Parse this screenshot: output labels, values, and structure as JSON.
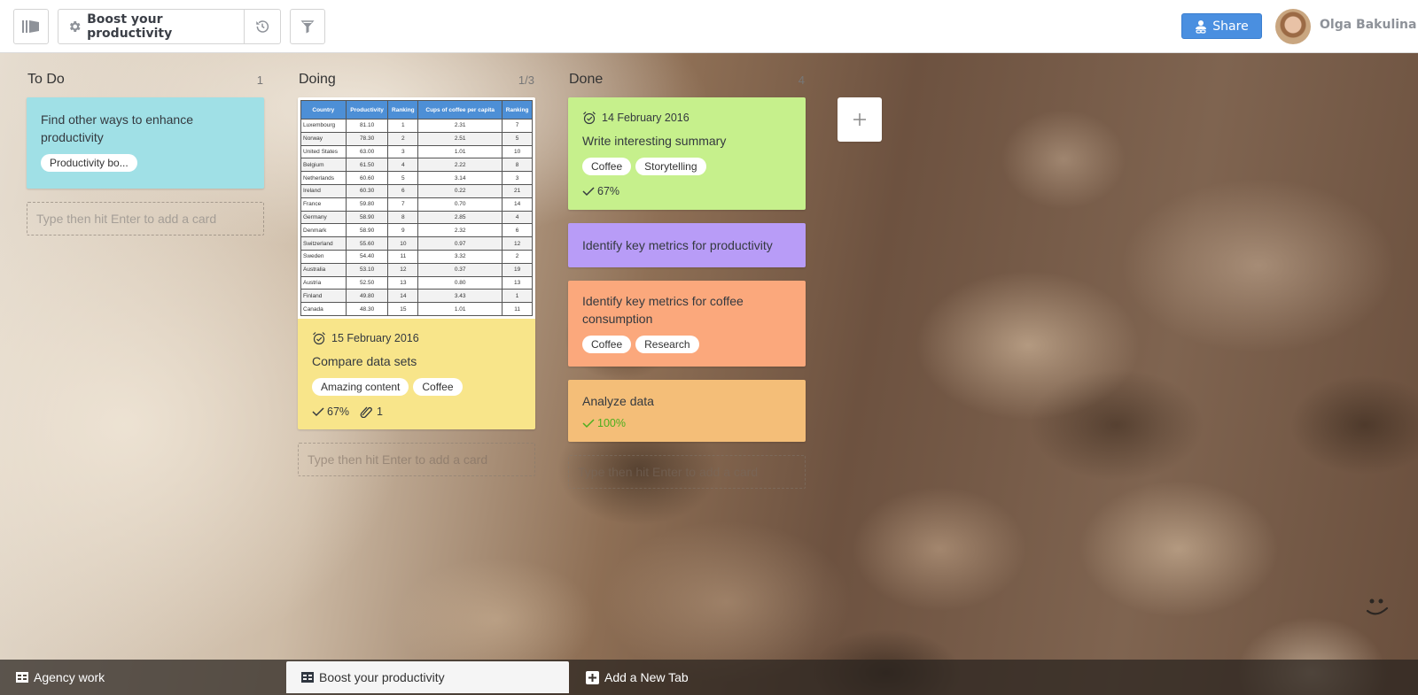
{
  "header": {
    "board_title": "Boost your productivity",
    "share_label": "Share",
    "user_name": "Olga Bakulina",
    "icons": {
      "sidebar_toggle": "sidebar-toggle-icon",
      "settings": "gear-icon",
      "history": "history-icon",
      "filter": "filter-icon",
      "share": "share-user-link-icon"
    },
    "accent_color": "#4a8fe0"
  },
  "lists": [
    {
      "title": "To Do",
      "count": "1",
      "cards": [
        {
          "title": "Find other ways to enhance productivity",
          "color": "#a0e0e6",
          "tags": [
            "Productivity bo..."
          ]
        }
      ],
      "add_placeholder": "Type then hit Enter to add a card"
    },
    {
      "title": "Doing",
      "count": "1/3",
      "cards": [
        {
          "color": "#f8e58a",
          "cover_table": {
            "headers": [
              "Country",
              "Productivity",
              "Ranking",
              "Cups of coffee per capita",
              "Ranking"
            ],
            "rows": [
              [
                "Luxembourg",
                "81.10",
                "1",
                "2.31",
                "7"
              ],
              [
                "Norway",
                "78.30",
                "2",
                "2.51",
                "5"
              ],
              [
                "United States",
                "63.00",
                "3",
                "1.01",
                "10"
              ],
              [
                "Belgium",
                "61.50",
                "4",
                "2.22",
                "8"
              ],
              [
                "Netherlands",
                "60.60",
                "5",
                "3.14",
                "3"
              ],
              [
                "Ireland",
                "60.30",
                "6",
                "0.22",
                "21"
              ],
              [
                "France",
                "59.80",
                "7",
                "0.70",
                "14"
              ],
              [
                "Germany",
                "58.90",
                "8",
                "2.85",
                "4"
              ],
              [
                "Denmark",
                "58.90",
                "9",
                "2.32",
                "6"
              ],
              [
                "Switzerland",
                "55.60",
                "10",
                "0.97",
                "12"
              ],
              [
                "Sweden",
                "54.40",
                "11",
                "3.32",
                "2"
              ],
              [
                "Australia",
                "53.10",
                "12",
                "0.37",
                "19"
              ],
              [
                "Austria",
                "52.50",
                "13",
                "0.80",
                "13"
              ],
              [
                "Finland",
                "49.80",
                "14",
                "3.43",
                "1"
              ],
              [
                "Canada",
                "48.30",
                "15",
                "1.01",
                "11"
              ]
            ]
          },
          "due_date": "15 February 2016",
          "title": "Compare data sets",
          "tags": [
            "Amazing content",
            "Coffee"
          ],
          "checklist": "67%",
          "attachments": "1"
        }
      ],
      "add_placeholder": "Type then hit Enter to add a card"
    },
    {
      "title": "Done",
      "count": "4",
      "cards": [
        {
          "color": "#c6f08c",
          "due_date": "14 February 2016",
          "title": "Write interesting summary",
          "tags": [
            "Coffee",
            "Storytelling"
          ],
          "checklist": "67%"
        },
        {
          "color": "#b89cf7",
          "title": "Identify key metrics for productivity"
        },
        {
          "color": "#fba87c",
          "title": "Identify key metrics for coffee consumption",
          "tags": [
            "Coffee",
            "Research"
          ]
        },
        {
          "color": "#f4be78",
          "title": "Analyze data",
          "checklist": "100%",
          "checklist_color": "#4caf1e"
        }
      ],
      "add_placeholder": "Type then hit Enter to add a card"
    }
  ],
  "add_list_icon": "plus-icon",
  "bottom_tabs": {
    "items": [
      {
        "label": "Agency work",
        "active": false
      },
      {
        "label": "Boost your productivity",
        "active": true
      }
    ],
    "add_tab_label": "Add a New Tab"
  },
  "feedback_icon": "smiley-icon"
}
